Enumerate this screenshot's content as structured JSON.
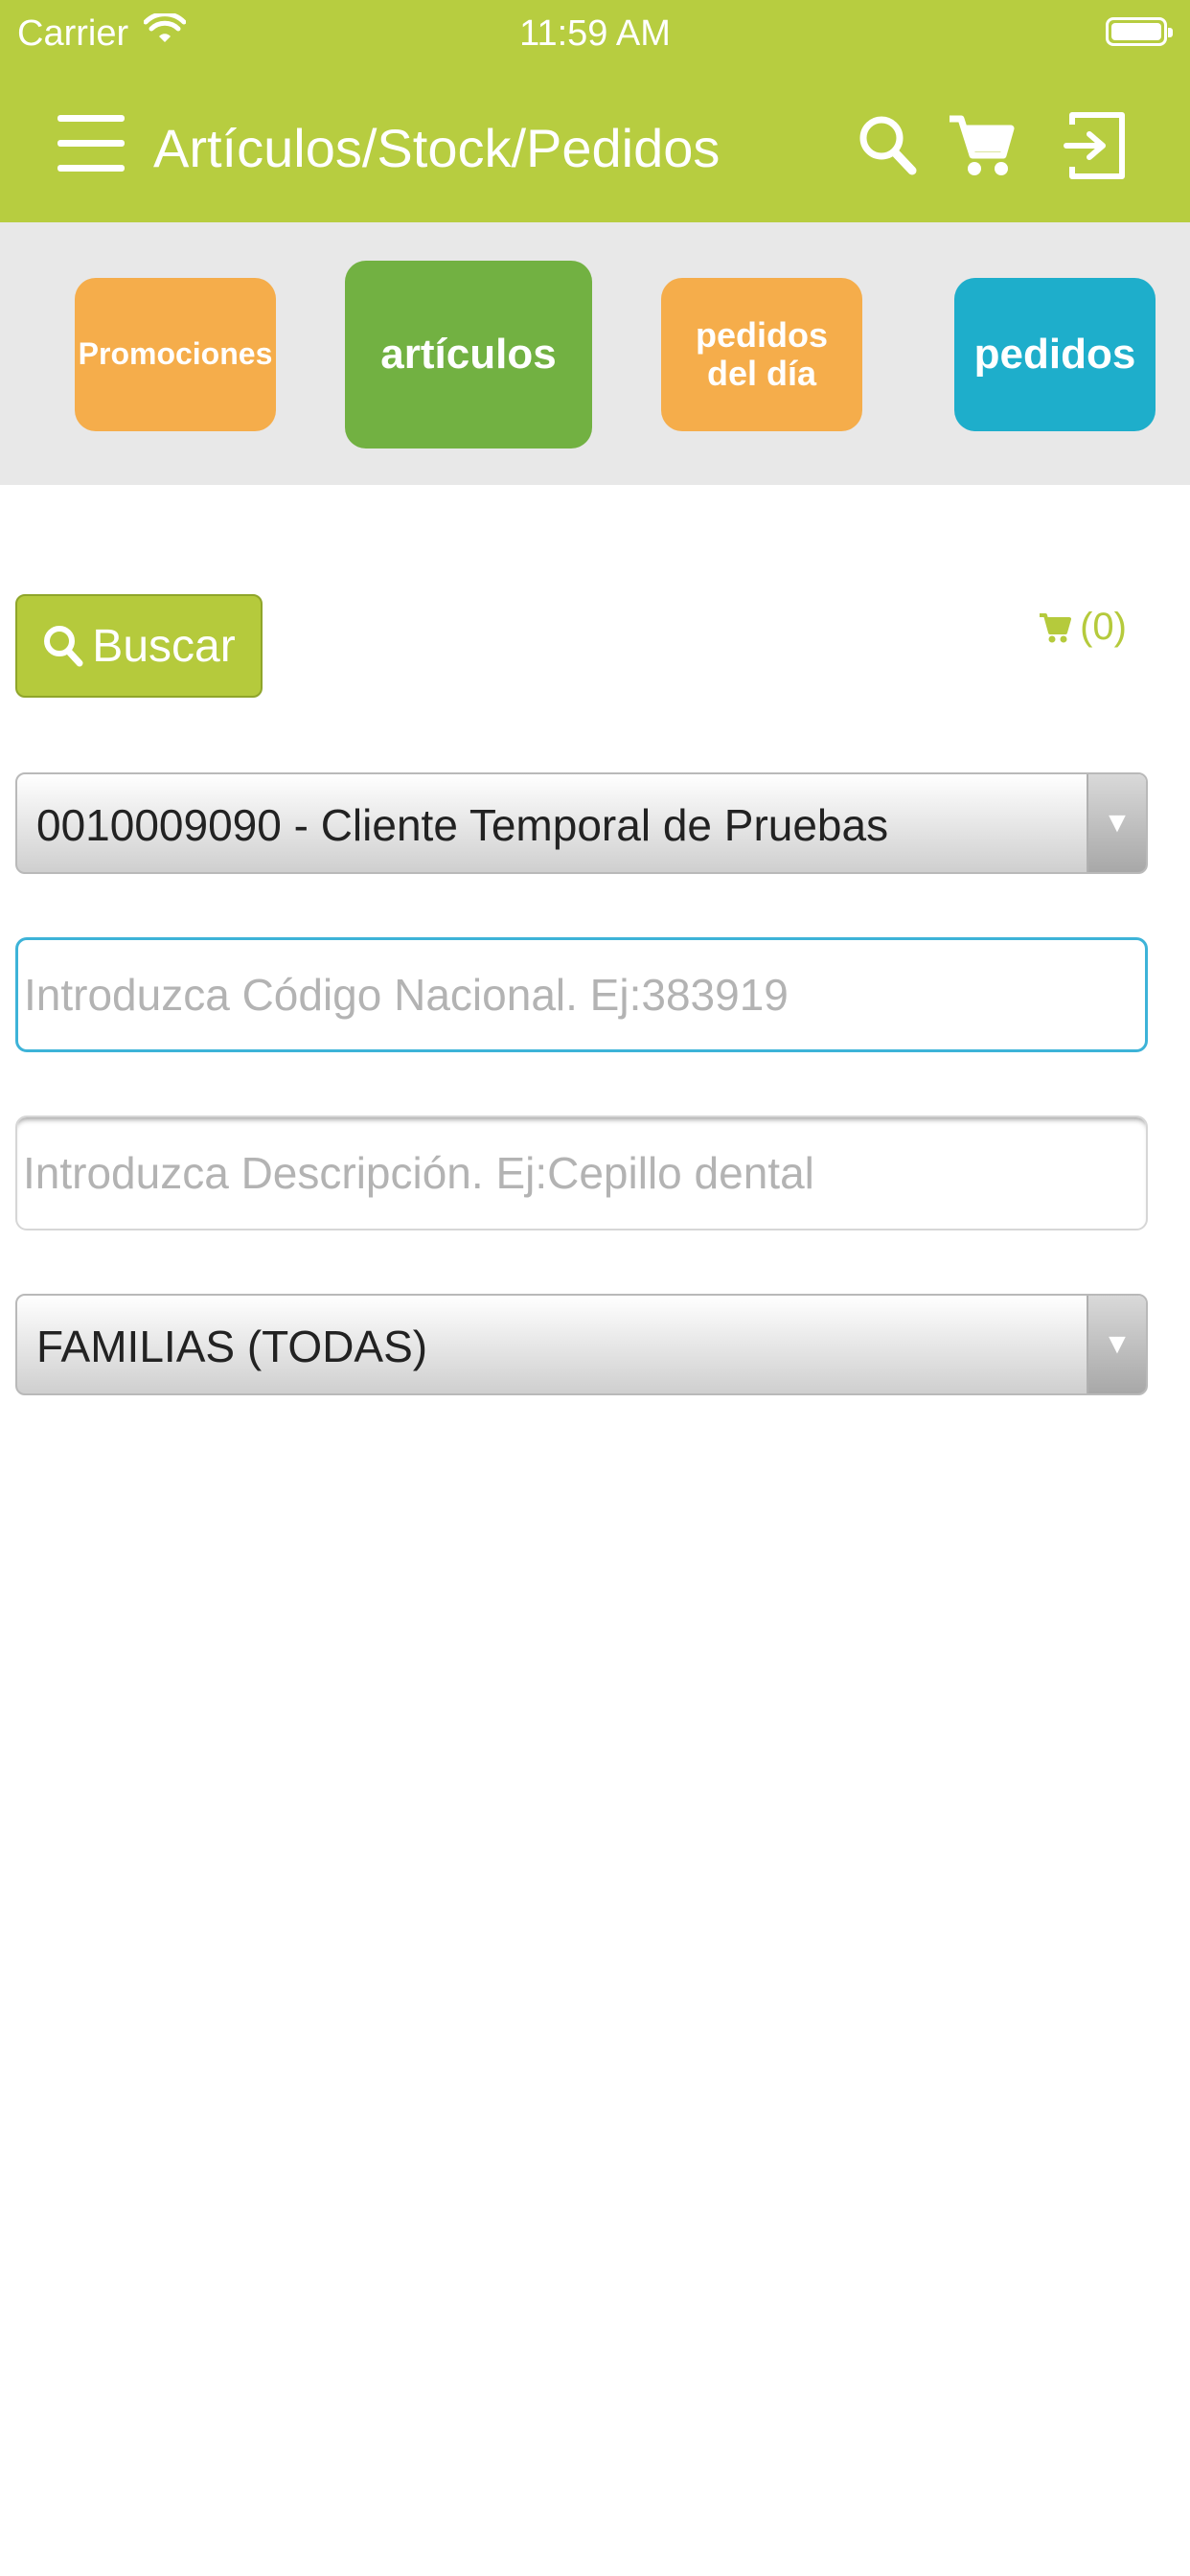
{
  "status_bar": {
    "carrier": "Carrier",
    "time": "11:59 AM"
  },
  "navbar": {
    "title": "Artículos/Stock/Pedidos",
    "icons": [
      "menu-icon",
      "search-icon",
      "cart-icon",
      "logout-icon"
    ]
  },
  "tiles": {
    "promociones": "Promociones",
    "articulos": "artículos",
    "pedidos_dia_line1": "pedidos",
    "pedidos_dia_line2": "del día",
    "pedidos": "pedidos"
  },
  "actions": {
    "buscar_label": "Buscar",
    "cart_count": "(0)"
  },
  "form": {
    "cliente_selected": "0010009090 - Cliente Temporal de Pruebas",
    "codigo_placeholder": "Introduzca Código Nacional. Ej:383919",
    "descripcion_placeholder": "Introduzca Descripción. Ej:Cepillo dental",
    "familia_selected": "FAMILIAS (TODAS)"
  },
  "colors": {
    "header": "#b7cd40",
    "tile_orange": "#f5ad4b",
    "tile_green": "#72b142",
    "tile_blue": "#1eaecb",
    "focus_border": "#3db3d8"
  }
}
